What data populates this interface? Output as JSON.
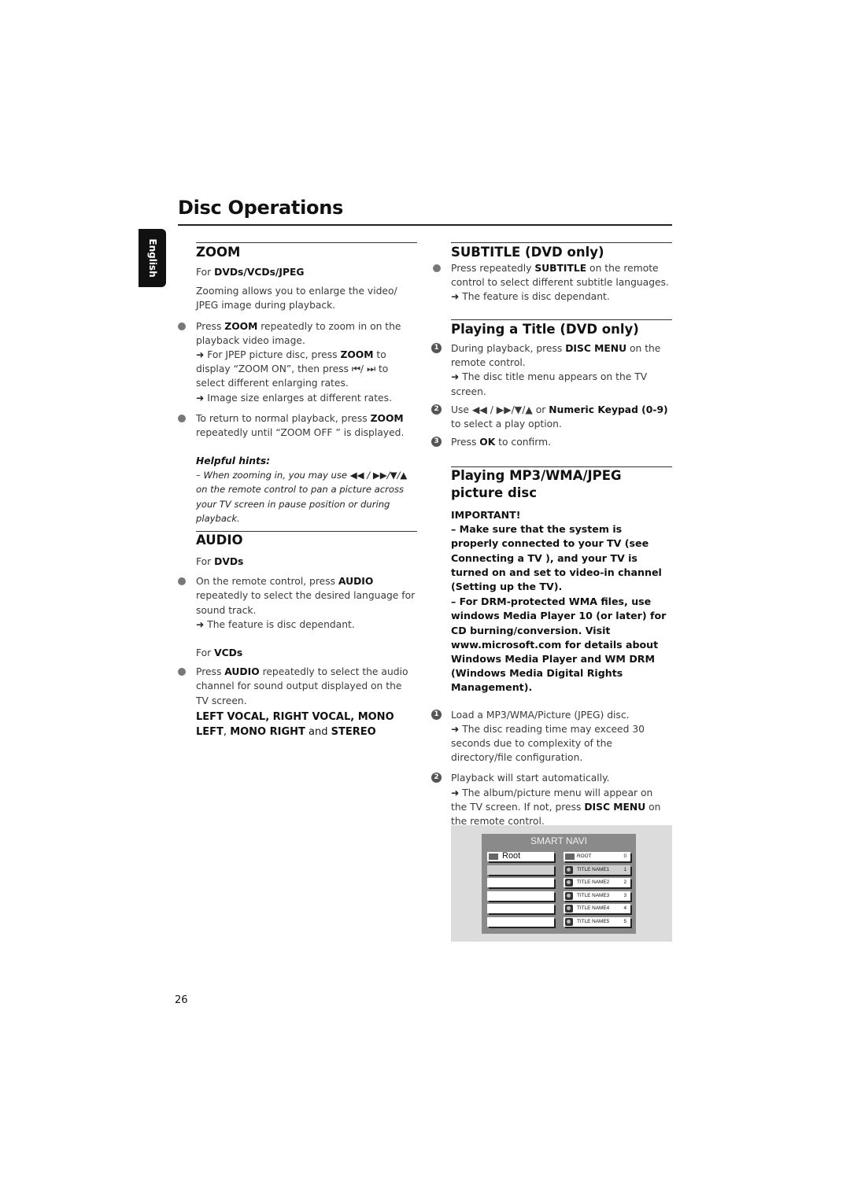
{
  "page": {
    "title": "Disc Operations",
    "language_tab": "English",
    "page_number": "26"
  },
  "zoom": {
    "heading": "ZOOM",
    "for_prefix": "For ",
    "for_value": "DVDs/VCDs/JPEG",
    "intro": "Zooming allows you to enlarge the video/ JPEG image during playback.",
    "b1_pre": "Press ",
    "b1_key": "ZOOM",
    "b1_post": " repeatedly to zoom in on the playback video image.",
    "b1_arrow1_pre": " For JPEP picture disc, press ",
    "b1_arrow1_key": "ZOOM",
    "b1_arrow1_post": " to display “ZOOM ON”, then press ⏮/ ⏭ to select different enlarging rates.",
    "b1_arrow2": " Image size enlarges at different rates.",
    "b2_pre": "To return to normal playback, press ",
    "b2_key": "ZOOM",
    "b2_post": " repeatedly until “ZOOM OFF ” is displayed."
  },
  "hints": {
    "title": "Helpful hints:",
    "text": "–  When zooming in, you may use ◀◀ / ▶▶/▼/▲ on the remote control to pan a picture across your TV screen in pause position or during playback."
  },
  "audio": {
    "heading": "AUDIO",
    "dvd_prefix": "For ",
    "dvd_value": "DVDs",
    "dvd_b_pre": "On the remote control, press ",
    "dvd_b_key": "AUDIO",
    "dvd_b_post": " repeatedly to select the desired language for sound track.",
    "dvd_arrow": " The feature is disc dependant.",
    "vcd_prefix": "For ",
    "vcd_value": "VCDs",
    "vcd_b_pre": "Press ",
    "vcd_b_key": "AUDIO",
    "vcd_b_post": " repeatedly to select the audio channel for sound output displayed on the TV screen.",
    "modes_1": "LEFT  VOCAL, RIGHT  VOCAL, MONO LEFT",
    "modes_sep": ", ",
    "modes_2": "MONO RIGHT",
    "modes_and": " and ",
    "modes_3": "STEREO"
  },
  "subtitle": {
    "heading": "SUBTITLE (DVD only)",
    "b_pre": "Press repeatedly ",
    "b_key": "SUBTITLE",
    "b_post": " on the remote control to select different subtitle languages.",
    "arrow": " The feature is disc dependant."
  },
  "title_play": {
    "heading": "Playing a Title (DVD only)",
    "s1_pre": "During playback, press ",
    "s1_key": "DISC MENU",
    "s1_post": " on the remote control.",
    "s1_arrow": " The disc title menu appears on the TV screen.",
    "s2_pre": "Use ◀◀ / ▶▶/▼/▲  or ",
    "s2_key": "Numeric Keypad (0-9)",
    "s2_post": " to select a play option.",
    "s3_pre": "Press ",
    "s3_key": "OK",
    "s3_post": " to confirm."
  },
  "mp3": {
    "heading": "Playing MP3/WMA/JPEG picture disc",
    "important_label": "IMPORTANT!",
    "important_1": "–  Make sure that the system is properly connected to your TV (see Connecting a TV ), and your TV is turned on and set to video-in channel (Setting up the TV).",
    "important_2": "–  For DRM-protected WMA files, use windows Media Player 10 (or later) for CD burning/conversion. Visit www.microsoft.com for details about Windows Media Player and WM DRM (Windows Media Digital Rights Management).",
    "s1": "Load a MP3/WMA/Picture (JPEG) disc.",
    "s1_arrow": " The disc reading time may exceed 30 seconds due to complexity of the directory/file configuration.",
    "s2": "Playback will start automatically.",
    "s2_arrow_pre": " The album/picture menu will appear on the TV screen. If not, press ",
    "s2_arrow_key": "DISC MENU",
    "s2_arrow_post": " on the remote control."
  },
  "smart_navi": {
    "title": "SMART NAVI",
    "left": [
      {
        "label": "Root",
        "icon": "folder-icon",
        "selected": false
      },
      {
        "label": "",
        "selected": true
      },
      {
        "label": "",
        "selected": false
      },
      {
        "label": "",
        "selected": false
      },
      {
        "label": "",
        "selected": false
      },
      {
        "label": "",
        "selected": false
      }
    ],
    "right": [
      {
        "label": "ROOT",
        "num": "0",
        "icon": "folder-icon",
        "selected": false
      },
      {
        "label": "TITLE NAME1",
        "num": "1",
        "icon": "picture-icon",
        "selected": true
      },
      {
        "label": "TITLE NAME2",
        "num": "2",
        "icon": "picture-icon",
        "selected": false
      },
      {
        "label": "TITLE NAME3",
        "num": "3",
        "icon": "picture-icon",
        "selected": false
      },
      {
        "label": "TITLE NAME4",
        "num": "4",
        "icon": "picture-icon",
        "selected": false
      },
      {
        "label": "TITLE NAME5",
        "num": "5",
        "icon": "picture-icon",
        "selected": false
      }
    ]
  },
  "glyphs": {
    "arrow": "➜",
    "step1": "1",
    "step2": "2",
    "step3": "3"
  }
}
